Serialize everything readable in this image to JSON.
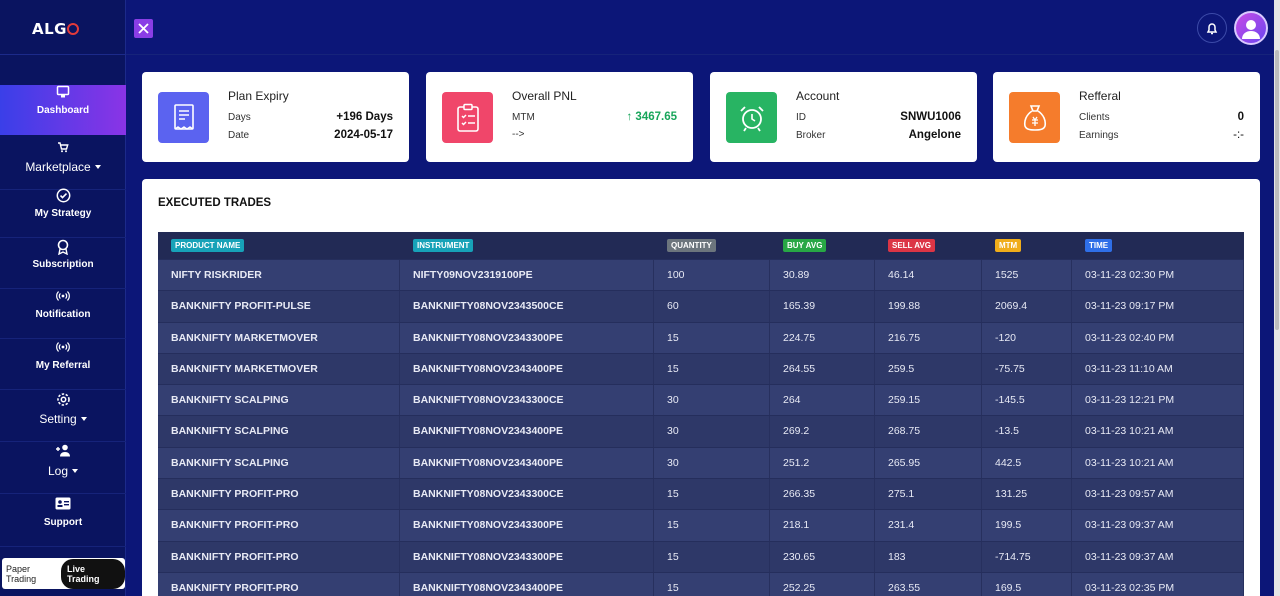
{
  "brand": {
    "logo_text": "ALG"
  },
  "sidebar": {
    "items": [
      {
        "label": "Dashboard",
        "icon": "monitor-icon"
      },
      {
        "label": "Marketplace",
        "icon": "cart-icon"
      },
      {
        "label": "My Strategy",
        "icon": "check-circle-icon"
      },
      {
        "label": "Subscription",
        "icon": "award-icon"
      },
      {
        "label": "Notification",
        "icon": "broadcast-icon"
      },
      {
        "label": "My Referral",
        "icon": "broadcast-icon"
      },
      {
        "label": "Setting",
        "icon": "gear-icon"
      },
      {
        "label": "Log",
        "icon": "user-plus-icon"
      },
      {
        "label": "Support",
        "icon": "id-card-icon"
      }
    ],
    "mode_toggle": {
      "paper": "Paper Trading",
      "live": "Live Trading"
    }
  },
  "cards": {
    "plan": {
      "title": "Plan Expiry",
      "row1_label": "Days",
      "row1_value": "+196 Days",
      "row2_label": "Date",
      "row2_value": "2024-05-17",
      "color": "#5b63f0"
    },
    "pnl": {
      "title": "Overall PNL",
      "row1_label": "MTM",
      "row1_value": "3467.65",
      "row2_label": "-->",
      "row2_value": "",
      "color": "#f0466a"
    },
    "account": {
      "title": "Account",
      "row1_label": "ID",
      "row1_value": "SNWU1006",
      "row2_label": "Broker",
      "row2_value": "Angelone",
      "color": "#28b463"
    },
    "referral": {
      "title": "Refferal",
      "row1_label": "Clients",
      "row1_value": "0",
      "row2_label": "Earnings",
      "row2_value": "-:-",
      "color": "#f57c2c"
    }
  },
  "trades": {
    "title": "EXECUTED TRADES",
    "columns": [
      {
        "label": "PRODUCT NAME",
        "color": "#17a2b8"
      },
      {
        "label": "INSTRUMENT",
        "color": "#17a2b8"
      },
      {
        "label": "QUANTITY",
        "color": "#6c757d"
      },
      {
        "label": "BUY AVG",
        "color": "#28a745"
      },
      {
        "label": "SELL AVG",
        "color": "#dc3545"
      },
      {
        "label": "MTM",
        "color": "#f0ad1a"
      },
      {
        "label": "TIME",
        "color": "#2f6fe8"
      }
    ],
    "rows": [
      [
        "NIFTY RISKRIDER",
        "NIFTY09NOV2319100PE",
        "100",
        "30.89",
        "46.14",
        "1525",
        "03-11-23 02:30 PM"
      ],
      [
        "BANKNIFTY PROFIT-PULSE",
        "BANKNIFTY08NOV2343500CE",
        "60",
        "165.39",
        "199.88",
        "2069.4",
        "03-11-23 09:17 PM"
      ],
      [
        "BANKNIFTY MARKETMOVER",
        "BANKNIFTY08NOV2343300PE",
        "15",
        "224.75",
        "216.75",
        "-120",
        "03-11-23 02:40 PM"
      ],
      [
        "BANKNIFTY MARKETMOVER",
        "BANKNIFTY08NOV2343400PE",
        "15",
        "264.55",
        "259.5",
        "-75.75",
        "03-11-23 11:10 AM"
      ],
      [
        "BANKNIFTY SCALPING",
        "BANKNIFTY08NOV2343300CE",
        "30",
        "264",
        "259.15",
        "-145.5",
        "03-11-23 12:21 PM"
      ],
      [
        "BANKNIFTY SCALPING",
        "BANKNIFTY08NOV2343400PE",
        "30",
        "269.2",
        "268.75",
        "-13.5",
        "03-11-23 10:21 AM"
      ],
      [
        "BANKNIFTY SCALPING",
        "BANKNIFTY08NOV2343400PE",
        "30",
        "251.2",
        "265.95",
        "442.5",
        "03-11-23 10:21 AM"
      ],
      [
        "BANKNIFTY PROFIT-PRO",
        "BANKNIFTY08NOV2343300CE",
        "15",
        "266.35",
        "275.1",
        "131.25",
        "03-11-23 09:57 AM"
      ],
      [
        "BANKNIFTY PROFIT-PRO",
        "BANKNIFTY08NOV2343300PE",
        "15",
        "218.1",
        "231.4",
        "199.5",
        "03-11-23 09:37 AM"
      ],
      [
        "BANKNIFTY PROFIT-PRO",
        "BANKNIFTY08NOV2343300PE",
        "15",
        "230.65",
        "183",
        "-714.75",
        "03-11-23 09:37 AM"
      ],
      [
        "BANKNIFTY PROFIT-PRO",
        "BANKNIFTY08NOV2343400PE",
        "15",
        "252.25",
        "263.55",
        "169.5",
        "03-11-23 02:35 PM"
      ]
    ]
  }
}
